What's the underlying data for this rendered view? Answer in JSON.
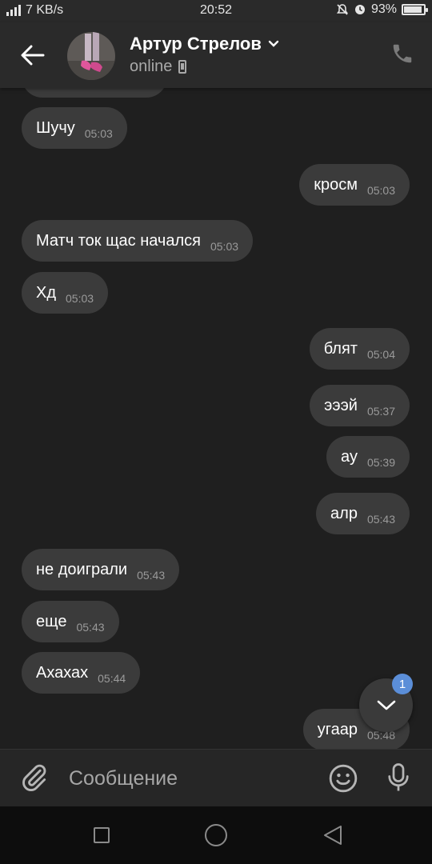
{
  "status_bar": {
    "network_speed": "7 KB/s",
    "time": "20:52",
    "battery": "93%",
    "battery_level": 0.93,
    "icons": [
      "signal-icon",
      "mute-icon",
      "alarm-icon",
      "battery-icon"
    ]
  },
  "header": {
    "contact_name": "Артур Стрелов",
    "status": "online",
    "icons": [
      "back-arrow-icon",
      "chevron-down-icon",
      "mobile-device-icon",
      "phone-icon"
    ]
  },
  "messages": [
    {
      "direction": "in",
      "text": "Шучу",
      "time": "05:03"
    },
    {
      "direction": "out",
      "text": "кросм",
      "time": "05:03"
    },
    {
      "direction": "in",
      "text": "Матч ток щас начался",
      "time": "05:03"
    },
    {
      "direction": "in",
      "text": "Хд",
      "time": "05:03"
    },
    {
      "direction": "out",
      "text": "блят",
      "time": "05:04"
    },
    {
      "direction": "out",
      "text": "эээй",
      "time": "05:37"
    },
    {
      "direction": "out",
      "text": "ау",
      "time": "05:39"
    },
    {
      "direction": "out",
      "text": "алр",
      "time": "05:43"
    },
    {
      "direction": "in",
      "text": "не доиграли",
      "time": "05:43"
    },
    {
      "direction": "in",
      "text": "еще",
      "time": "05:43"
    },
    {
      "direction": "in",
      "text": "Ахахах",
      "time": "05:44"
    },
    {
      "direction": "out",
      "text": "угаар",
      "time": "05:48"
    }
  ],
  "scroll_down": {
    "unread_count": "1",
    "badge_color": "#5b8ed8"
  },
  "composer": {
    "placeholder": "Сообщение",
    "icons": [
      "paperclip-icon",
      "emoji-icon",
      "microphone-icon"
    ]
  },
  "nav_bar": {
    "icons": [
      "recents-icon",
      "home-icon",
      "back-icon"
    ]
  },
  "colors": {
    "background": "#1f1f1f",
    "header": "#2a2a2a",
    "bubble": "#3b3b3b",
    "timestamp": "#9a9a9a"
  }
}
